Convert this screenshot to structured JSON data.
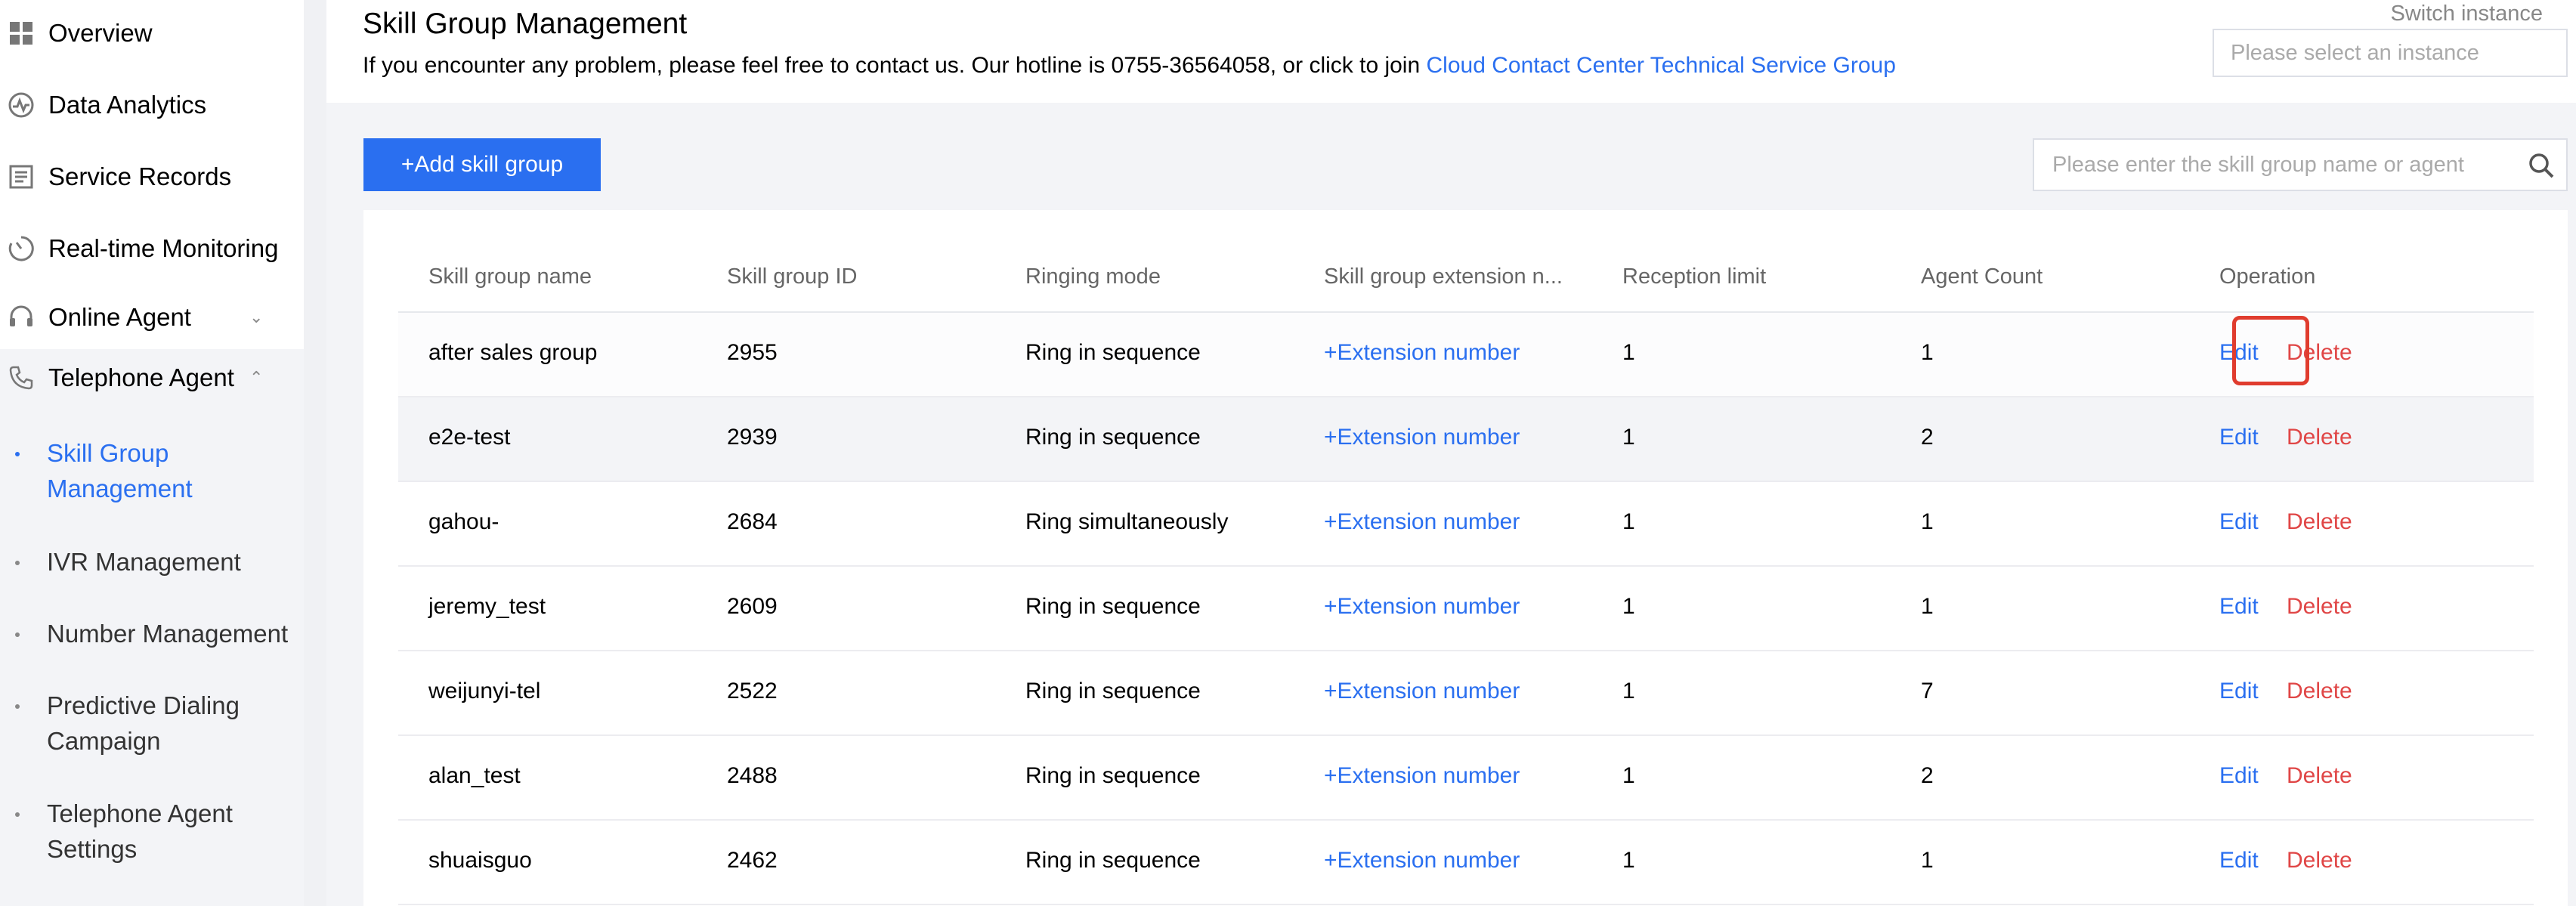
{
  "sidebar": {
    "items": [
      {
        "label": "Overview",
        "icon": "grid-icon"
      },
      {
        "label": "Data Analytics",
        "icon": "analytics-icon"
      },
      {
        "label": "Service Records",
        "icon": "records-icon"
      },
      {
        "label": "Real-time Monitoring",
        "icon": "monitor-icon"
      },
      {
        "label": "Online Agent",
        "icon": "headset-icon"
      },
      {
        "label": "Telephone Agent",
        "icon": "phone-icon"
      }
    ],
    "sub_items": [
      {
        "label": "Skill Group Management"
      },
      {
        "label": "IVR Management"
      },
      {
        "label": "Number Management"
      },
      {
        "label": "Predictive Dialing Campaign"
      },
      {
        "label": "Telephone Agent Settings"
      }
    ]
  },
  "header": {
    "title": "Skill Group Management",
    "notice": "If you encounter any problem, please feel free to contact us. Our hotline is 0755-36564058, or click to join ",
    "notice_link": "Cloud Contact Center Technical Service Group",
    "switch_label": "Switch instance",
    "instance_placeholder": "Please select an instance"
  },
  "toolbar": {
    "add_label": "+Add skill group",
    "search_placeholder": "Please enter the skill group name or agent"
  },
  "table": {
    "columns": [
      "Skill group name",
      "Skill group ID",
      "Ringing mode",
      "Skill group extension n...",
      "Reception limit",
      "Agent Count",
      "Operation"
    ],
    "rows": [
      {
        "name": "after sales group",
        "id": "2955",
        "mode": "Ring in sequence",
        "ext": "+Extension number",
        "limit": "1",
        "count": "1"
      },
      {
        "name": "e2e-test",
        "id": "2939",
        "mode": "Ring in sequence",
        "ext": "+Extension number",
        "limit": "1",
        "count": "2"
      },
      {
        "name": "gahou-",
        "id": "2684",
        "mode": "Ring simultaneously",
        "ext": "+Extension number",
        "limit": "1",
        "count": "1"
      },
      {
        "name": "jeremy_test",
        "id": "2609",
        "mode": "Ring in sequence",
        "ext": "+Extension number",
        "limit": "1",
        "count": "1"
      },
      {
        "name": "weijunyi-tel",
        "id": "2522",
        "mode": "Ring in sequence",
        "ext": "+Extension number",
        "limit": "1",
        "count": "7"
      },
      {
        "name": "alan_test",
        "id": "2488",
        "mode": "Ring in sequence",
        "ext": "+Extension number",
        "limit": "1",
        "count": "2"
      },
      {
        "name": "shuaisguo",
        "id": "2462",
        "mode": "Ring in sequence",
        "ext": "+Extension number",
        "limit": "1",
        "count": "1"
      }
    ],
    "edit_label": "Edit",
    "delete_label": "Delete"
  },
  "colors": {
    "accent": "#2a6ff0",
    "danger": "#e04646",
    "highlight": "#e03c2e"
  }
}
